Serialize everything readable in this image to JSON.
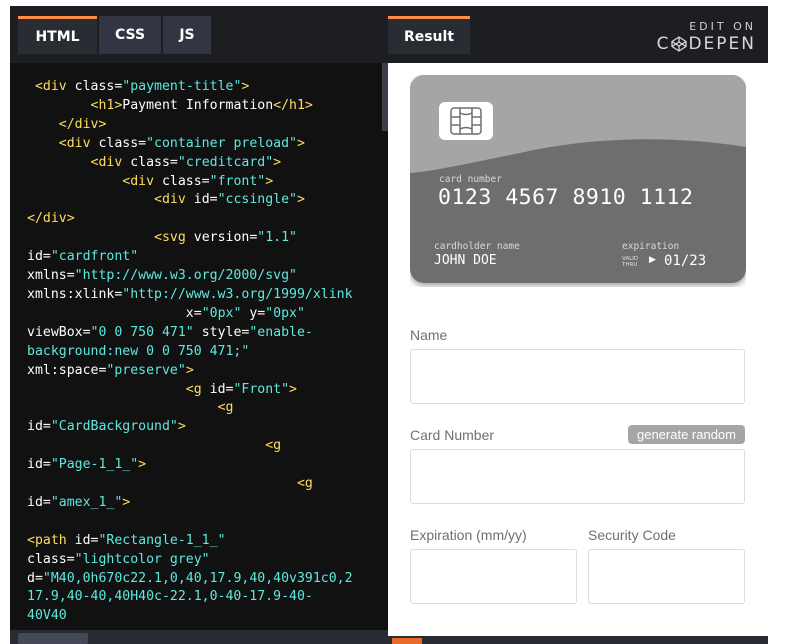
{
  "editor": {
    "tabs": [
      {
        "label": "HTML",
        "active": true
      },
      {
        "label": "CSS",
        "active": false
      },
      {
        "label": "JS",
        "active": false
      }
    ],
    "code": {
      "l1_ind": " ",
      "l1_tag_open": "<div",
      "l1_attr": " class=",
      "l1_str": "\"payment-title\"",
      "l1_tag_close": ">",
      "l2_ind": "        ",
      "l2_tag_open": "<h1>",
      "l2_text": "Payment Information",
      "l2_tag_close": "</h1>",
      "l3_ind": "    ",
      "l3_tag": "</div>",
      "l4_ind": "    ",
      "l4_tag_open": "<div",
      "l4_attr": " class=",
      "l4_str": "\"container preload\"",
      "l4_tag_close": ">",
      "l5_ind": "        ",
      "l5_tag_open": "<div",
      "l5_attr": " class=",
      "l5_str": "\"creditcard\"",
      "l5_tag_close": ">",
      "l6_ind": "            ",
      "l6_tag_open": "<div",
      "l6_attr": " class=",
      "l6_str": "\"front\"",
      "l6_tag_close": ">",
      "l7_ind": "                ",
      "l7_tag_open": "<div",
      "l7_attr": " id=",
      "l7_str": "\"ccsingle\"",
      "l7_tag_close": ">",
      "l8_tag": "</div>",
      "l9_ind": "                ",
      "l9_tag_open": "<svg",
      "l9_attr": " version=",
      "l9_str": "\"1.1\"",
      "l10_attr": "id=",
      "l10_str": "\"cardfront\"",
      "l11_attr": "xmlns=",
      "l11_str": "\"http://www.w3.org/2000/svg\"",
      "l12_attr": "xmlns:xlink=",
      "l12_str": "\"http://www.w3.org/1999/xlink",
      "l13_ind": "                    ",
      "l13_attr1": "x=",
      "l13_str1": "\"0px\"",
      "l13_attr2": " y=",
      "l13_str2": "\"0px\"",
      "l14_attr": "viewBox=",
      "l14_str": "\"0 0 750 471\"",
      "l14_attr2": " style=",
      "l14_str2": "\"enable-",
      "l15_str": "background:new 0 0 750 471;\"",
      "l16_attr": "xml:space=",
      "l16_str": "\"preserve\"",
      "l16_tag": ">",
      "l17_ind": "                    ",
      "l17_tag_open": "<g",
      "l17_attr": " id=",
      "l17_str": "\"Front\"",
      "l17_tag_close": ">",
      "l18_ind": "                        ",
      "l18_tag": "<g",
      "l19_attr": "id=",
      "l19_str": "\"CardBackground\"",
      "l19_tag": ">",
      "l20_ind": "                              ",
      "l20_tag": "<g",
      "l21_attr": "id=",
      "l21_str": "\"Page-1_1_\"",
      "l21_tag": ">",
      "l22_ind": "                                  ",
      "l22_tag": "<g",
      "l23_attr": "id=",
      "l23_str": "\"amex_1_\"",
      "l23_tag": ">",
      "l25_tag": "<path",
      "l25_attr": " id=",
      "l25_str": "\"Rectangle-1_1_\"",
      "l26_attr": "class=",
      "l26_str": "\"lightcolor grey\"",
      "l27_attr": "d=",
      "l27_str": "\"M40,0h670c22.1,0,40,17.9,40,40v391c0,2",
      "l28_str": "17.9,40-40,40H40c-22.1,0-40-17.9-40-",
      "l29_str": "40V40"
    }
  },
  "result": {
    "tab_label": "Result",
    "edit_on": "EDIT ON",
    "codepen_logo_c": "C",
    "codepen_logo_rest": "DEPEN",
    "card": {
      "number_label": "card number",
      "number": "0123 4567 8910 1112",
      "holder_label": "cardholder name",
      "holder": "JOHN DOE",
      "expiration_label": "expiration",
      "valid_thru": "VALID THRU",
      "expiry": "01/23"
    },
    "form": {
      "name_label": "Name",
      "card_number_label": "Card Number",
      "generate_random_label": "generate random",
      "expiration_label": "Expiration (mm/yy)",
      "security_label": "Security Code"
    }
  },
  "colors": {
    "accent": "#ff8c42",
    "editor_bg": "#111111",
    "tag": "#ffde5e",
    "string": "#5ee9e0",
    "card_dark": "#6e6e6e",
    "card_light": "#a5a5a5"
  }
}
